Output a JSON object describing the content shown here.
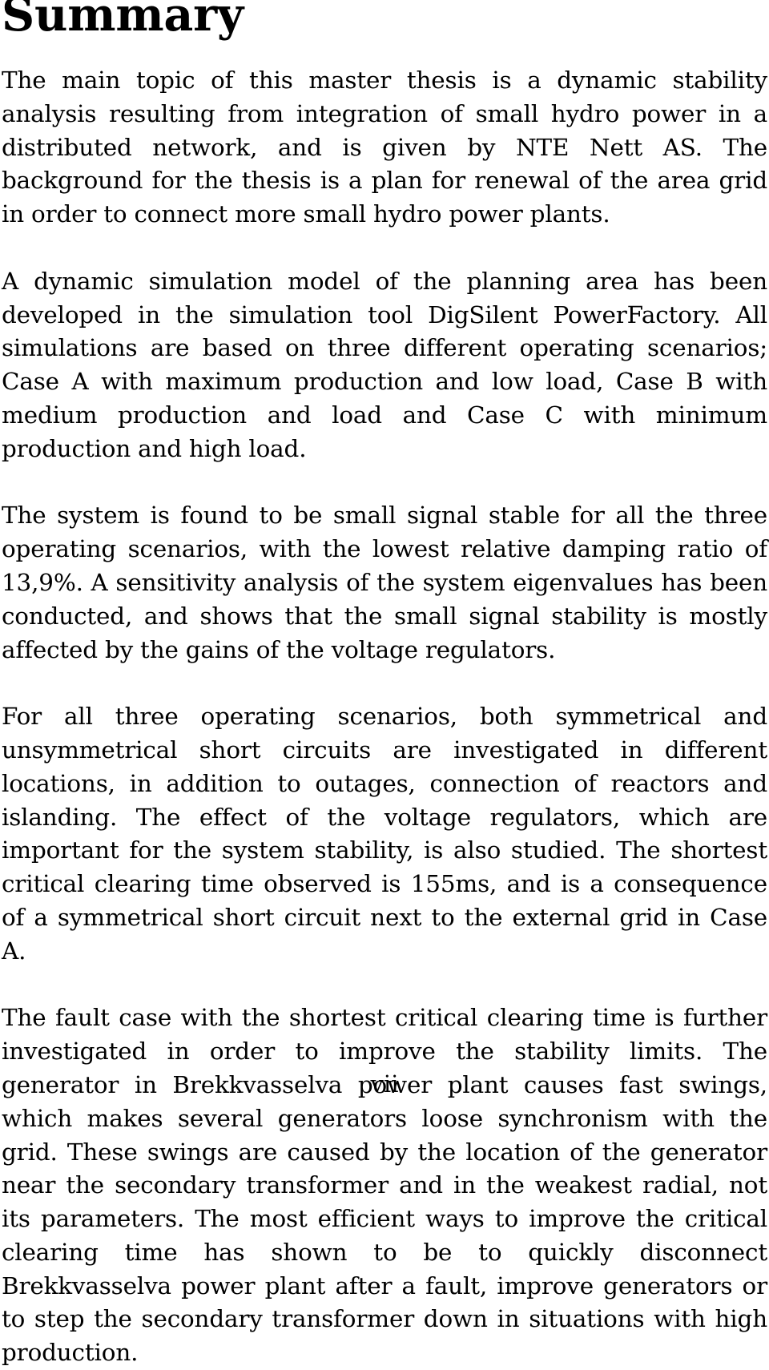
{
  "document": {
    "heading": "Summary",
    "paragraphs": [
      "The main topic of this master thesis is a dynamic stability analysis resulting from integration of small hydro power in a distributed network, and is given by NTE Nett AS. The background for the thesis is a plan for renewal of the area grid in order to connect more small hydro power plants.",
      "A dynamic simulation model of the planning area has been developed in the simulation tool DigSilent PowerFactory. All simulations are based on three different operating scenarios; Case A with maximum production and low load, Case B with medium production and load and Case C with minimum production and high load.",
      "The system is found to be small signal stable for all the three operating scenarios, with the lowest relative damping ratio of 13,9%. A sensitivity analysis of the system eigenvalues has been conducted, and shows that the small signal stability is mostly affected by the gains of the voltage regulators.",
      "For all three operating scenarios, both symmetrical and unsymmetrical short circuits are investigated in different locations, in addition to outages, connection of reactors and islanding. The effect of the voltage regulators, which are important for the system stability, is also studied. The shortest critical clearing time observed is 155ms, and is a consequence of a symmetrical short circuit next to the external grid in Case A.",
      "The fault case with the shortest critical clearing time is further investigated in order to improve the stability limits. The generator in Brekkvasselva power plant causes fast swings, which makes several generators loose synchronism with the grid. These swings are caused by the location of the generator near the secondary transformer and in the weakest radial, not its parameters. The most efficient ways to improve the critical clearing time has shown to be to quickly disconnect Brekkvasselva power plant after a fault, improve generators or to step the secondary transformer down in situations with high production."
    ],
    "footer": {
      "page_number": "vii"
    },
    "colors": {
      "background": "#ffffff",
      "text": "#000000"
    }
  }
}
